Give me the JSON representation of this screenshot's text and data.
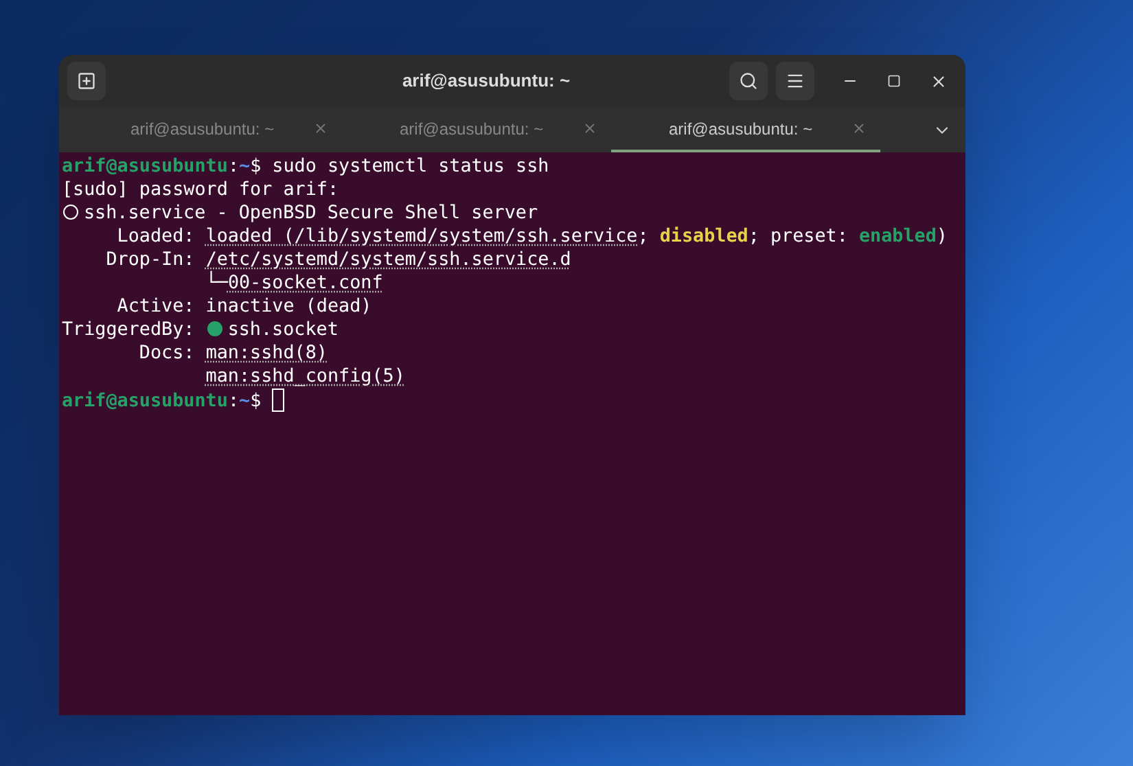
{
  "window": {
    "title": "arif@asusubuntu: ~"
  },
  "tabs": [
    {
      "label": "arif@asusubuntu: ~",
      "selected": false
    },
    {
      "label": "arif@asusubuntu: ~",
      "selected": false
    },
    {
      "label": "arif@asusubuntu: ~",
      "selected": true
    }
  ],
  "terminal": {
    "lines": [
      [
        {
          "kind": "user",
          "text": "arif@asusubuntu"
        },
        {
          "kind": "plain",
          "text": ":"
        },
        {
          "kind": "path",
          "text": "~"
        },
        {
          "kind": "plain",
          "text": "$ sudo systemctl status ssh"
        }
      ],
      [
        {
          "kind": "plain",
          "text": "[sudo] password for arif:"
        }
      ],
      [
        {
          "kind": "circle-outline"
        },
        {
          "kind": "plain",
          "text": "ssh.service - OpenBSD Secure Shell server"
        }
      ],
      [
        {
          "kind": "plain",
          "text": "     Loaded: "
        },
        {
          "kind": "link",
          "text": "loaded (/lib/systemd/system/ssh.service"
        },
        {
          "kind": "plain",
          "text": "; "
        },
        {
          "kind": "warn",
          "text": "disabled"
        },
        {
          "kind": "plain",
          "text": "; preset: "
        },
        {
          "kind": "ok",
          "text": "enabled"
        },
        {
          "kind": "plain",
          "text": ")"
        }
      ],
      [
        {
          "kind": "plain",
          "text": "    Drop-In: "
        },
        {
          "kind": "link",
          "text": "/etc/systemd/system/ssh.service.d"
        }
      ],
      [
        {
          "kind": "plain",
          "text": "             └─"
        },
        {
          "kind": "link",
          "text": "00-socket.conf"
        }
      ],
      [
        {
          "kind": "plain",
          "text": "     Active: inactive (dead)"
        }
      ],
      [
        {
          "kind": "plain",
          "text": "TriggeredBy: "
        },
        {
          "kind": "circle-filled"
        },
        {
          "kind": "plain",
          "text": "ssh.socket"
        }
      ],
      [
        {
          "kind": "plain",
          "text": "       Docs: "
        },
        {
          "kind": "link",
          "text": "man:sshd(8)"
        }
      ],
      [
        {
          "kind": "link-indented",
          "text": "man:sshd_config(5)"
        }
      ],
      [
        {
          "kind": "user",
          "text": "arif@asusubuntu"
        },
        {
          "kind": "plain",
          "text": ":"
        },
        {
          "kind": "path",
          "text": "~"
        },
        {
          "kind": "plain",
          "text": "$ "
        },
        {
          "kind": "cursor"
        }
      ]
    ]
  }
}
